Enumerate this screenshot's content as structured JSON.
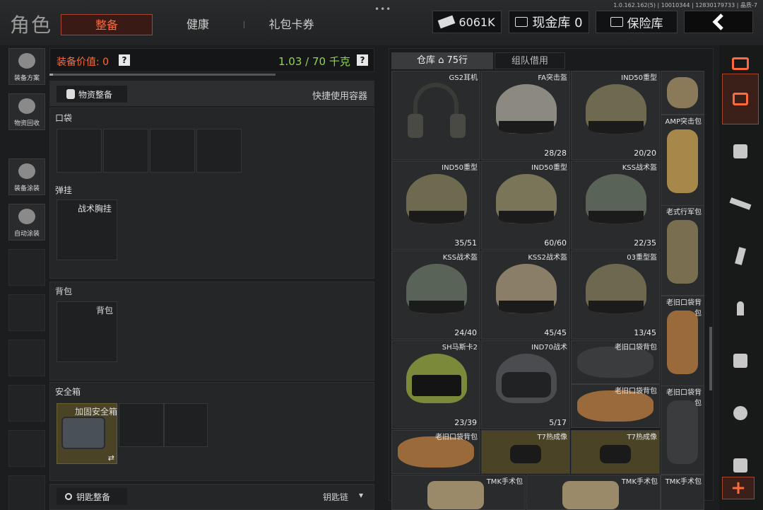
{
  "header": {
    "title": "角色",
    "tabs": [
      "整备",
      "健康",
      "礼包卡券"
    ],
    "version": "1.0.162.162(5) | 10010344 | 12830179733 | 晶质-7",
    "money": "6061K",
    "gold": "现金库 0",
    "insurance": "保险库"
  },
  "left_rail": [
    "装备方案",
    "物资回收",
    "装备涂装",
    "自动涂装"
  ],
  "loadout": {
    "value_label": "装备价值: 0",
    "weight": "1.03 / 70 千克",
    "weight_progress": 0.015,
    "supplies_btn": "物资整备",
    "quick_use": "快捷使用容器",
    "pocket": "口袋",
    "rig_section": "弹挂",
    "rig_item": "战术胸挂",
    "backpack_section": "背包",
    "backpack_item": "背包",
    "safebox_section": "安全箱",
    "safebox_item": "加固安全箱",
    "key_btn": "钥匙整备",
    "key_chain": "钥匙链"
  },
  "inventory": {
    "tab_warehouse": "仓库",
    "tab_warehouse_count": "75行",
    "tab_team": "组队借用",
    "items": [
      {
        "name": "GS2耳机",
        "dur": "",
        "color": "#3a3a38"
      },
      {
        "name": "FA突击盔",
        "dur": "28/28",
        "color": "#8c8a80"
      },
      {
        "name": "IND50重型",
        "dur": "20/20",
        "color": "#6e6a50"
      },
      {
        "name": "IND50重型",
        "dur": "35/51",
        "color": "#6e6a50"
      },
      {
        "name": "IND50重型",
        "dur": "60/60",
        "color": "#7a7458"
      },
      {
        "name": "KSS战术盔",
        "dur": "22/35",
        "color": "#5a6358"
      },
      {
        "name": "KSS战术盔",
        "dur": "24/40",
        "color": "#5a6358"
      },
      {
        "name": "KSS2战术盔",
        "dur": "45/45",
        "color": "#8a7e68"
      },
      {
        "name": "03重型盔",
        "dur": "13/45",
        "color": "#6e6850"
      },
      {
        "name": "SH马斯卡2",
        "dur": "23/39",
        "color": "#7a8a3a"
      },
      {
        "name": "IND70战术",
        "dur": "5/17",
        "color": "#4a4c50"
      }
    ],
    "bags": {
      "amp": "AMP突击包",
      "old_army": "老式行军包",
      "old_pocket": "老旧口袋背包",
      "t7": "T7热成像",
      "tmk": "TMK手术包"
    }
  }
}
